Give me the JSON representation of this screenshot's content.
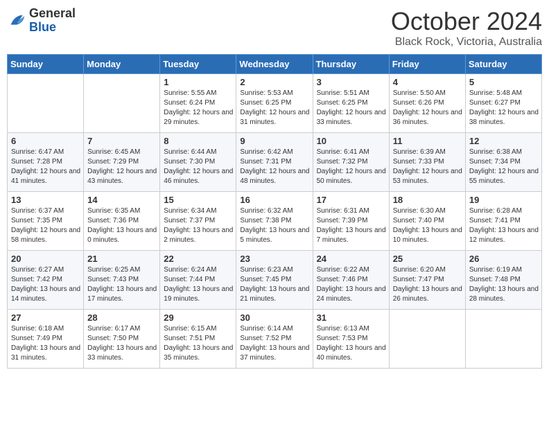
{
  "header": {
    "logo": {
      "general": "General",
      "blue": "Blue"
    },
    "title": "October 2024",
    "location": "Black Rock, Victoria, Australia"
  },
  "days_of_week": [
    "Sunday",
    "Monday",
    "Tuesday",
    "Wednesday",
    "Thursday",
    "Friday",
    "Saturday"
  ],
  "weeks": [
    [
      {
        "day": "",
        "sunrise": "",
        "sunset": "",
        "daylight": ""
      },
      {
        "day": "",
        "sunrise": "",
        "sunset": "",
        "daylight": ""
      },
      {
        "day": "1",
        "sunrise": "Sunrise: 5:55 AM",
        "sunset": "Sunset: 6:24 PM",
        "daylight": "Daylight: 12 hours and 29 minutes."
      },
      {
        "day": "2",
        "sunrise": "Sunrise: 5:53 AM",
        "sunset": "Sunset: 6:25 PM",
        "daylight": "Daylight: 12 hours and 31 minutes."
      },
      {
        "day": "3",
        "sunrise": "Sunrise: 5:51 AM",
        "sunset": "Sunset: 6:25 PM",
        "daylight": "Daylight: 12 hours and 33 minutes."
      },
      {
        "day": "4",
        "sunrise": "Sunrise: 5:50 AM",
        "sunset": "Sunset: 6:26 PM",
        "daylight": "Daylight: 12 hours and 36 minutes."
      },
      {
        "day": "5",
        "sunrise": "Sunrise: 5:48 AM",
        "sunset": "Sunset: 6:27 PM",
        "daylight": "Daylight: 12 hours and 38 minutes."
      }
    ],
    [
      {
        "day": "6",
        "sunrise": "Sunrise: 6:47 AM",
        "sunset": "Sunset: 7:28 PM",
        "daylight": "Daylight: 12 hours and 41 minutes."
      },
      {
        "day": "7",
        "sunrise": "Sunrise: 6:45 AM",
        "sunset": "Sunset: 7:29 PM",
        "daylight": "Daylight: 12 hours and 43 minutes."
      },
      {
        "day": "8",
        "sunrise": "Sunrise: 6:44 AM",
        "sunset": "Sunset: 7:30 PM",
        "daylight": "Daylight: 12 hours and 46 minutes."
      },
      {
        "day": "9",
        "sunrise": "Sunrise: 6:42 AM",
        "sunset": "Sunset: 7:31 PM",
        "daylight": "Daylight: 12 hours and 48 minutes."
      },
      {
        "day": "10",
        "sunrise": "Sunrise: 6:41 AM",
        "sunset": "Sunset: 7:32 PM",
        "daylight": "Daylight: 12 hours and 50 minutes."
      },
      {
        "day": "11",
        "sunrise": "Sunrise: 6:39 AM",
        "sunset": "Sunset: 7:33 PM",
        "daylight": "Daylight: 12 hours and 53 minutes."
      },
      {
        "day": "12",
        "sunrise": "Sunrise: 6:38 AM",
        "sunset": "Sunset: 7:34 PM",
        "daylight": "Daylight: 12 hours and 55 minutes."
      }
    ],
    [
      {
        "day": "13",
        "sunrise": "Sunrise: 6:37 AM",
        "sunset": "Sunset: 7:35 PM",
        "daylight": "Daylight: 12 hours and 58 minutes."
      },
      {
        "day": "14",
        "sunrise": "Sunrise: 6:35 AM",
        "sunset": "Sunset: 7:36 PM",
        "daylight": "Daylight: 13 hours and 0 minutes."
      },
      {
        "day": "15",
        "sunrise": "Sunrise: 6:34 AM",
        "sunset": "Sunset: 7:37 PM",
        "daylight": "Daylight: 13 hours and 2 minutes."
      },
      {
        "day": "16",
        "sunrise": "Sunrise: 6:32 AM",
        "sunset": "Sunset: 7:38 PM",
        "daylight": "Daylight: 13 hours and 5 minutes."
      },
      {
        "day": "17",
        "sunrise": "Sunrise: 6:31 AM",
        "sunset": "Sunset: 7:39 PM",
        "daylight": "Daylight: 13 hours and 7 minutes."
      },
      {
        "day": "18",
        "sunrise": "Sunrise: 6:30 AM",
        "sunset": "Sunset: 7:40 PM",
        "daylight": "Daylight: 13 hours and 10 minutes."
      },
      {
        "day": "19",
        "sunrise": "Sunrise: 6:28 AM",
        "sunset": "Sunset: 7:41 PM",
        "daylight": "Daylight: 13 hours and 12 minutes."
      }
    ],
    [
      {
        "day": "20",
        "sunrise": "Sunrise: 6:27 AM",
        "sunset": "Sunset: 7:42 PM",
        "daylight": "Daylight: 13 hours and 14 minutes."
      },
      {
        "day": "21",
        "sunrise": "Sunrise: 6:25 AM",
        "sunset": "Sunset: 7:43 PM",
        "daylight": "Daylight: 13 hours and 17 minutes."
      },
      {
        "day": "22",
        "sunrise": "Sunrise: 6:24 AM",
        "sunset": "Sunset: 7:44 PM",
        "daylight": "Daylight: 13 hours and 19 minutes."
      },
      {
        "day": "23",
        "sunrise": "Sunrise: 6:23 AM",
        "sunset": "Sunset: 7:45 PM",
        "daylight": "Daylight: 13 hours and 21 minutes."
      },
      {
        "day": "24",
        "sunrise": "Sunrise: 6:22 AM",
        "sunset": "Sunset: 7:46 PM",
        "daylight": "Daylight: 13 hours and 24 minutes."
      },
      {
        "day": "25",
        "sunrise": "Sunrise: 6:20 AM",
        "sunset": "Sunset: 7:47 PM",
        "daylight": "Daylight: 13 hours and 26 minutes."
      },
      {
        "day": "26",
        "sunrise": "Sunrise: 6:19 AM",
        "sunset": "Sunset: 7:48 PM",
        "daylight": "Daylight: 13 hours and 28 minutes."
      }
    ],
    [
      {
        "day": "27",
        "sunrise": "Sunrise: 6:18 AM",
        "sunset": "Sunset: 7:49 PM",
        "daylight": "Daylight: 13 hours and 31 minutes."
      },
      {
        "day": "28",
        "sunrise": "Sunrise: 6:17 AM",
        "sunset": "Sunset: 7:50 PM",
        "daylight": "Daylight: 13 hours and 33 minutes."
      },
      {
        "day": "29",
        "sunrise": "Sunrise: 6:15 AM",
        "sunset": "Sunset: 7:51 PM",
        "daylight": "Daylight: 13 hours and 35 minutes."
      },
      {
        "day": "30",
        "sunrise": "Sunrise: 6:14 AM",
        "sunset": "Sunset: 7:52 PM",
        "daylight": "Daylight: 13 hours and 37 minutes."
      },
      {
        "day": "31",
        "sunrise": "Sunrise: 6:13 AM",
        "sunset": "Sunset: 7:53 PM",
        "daylight": "Daylight: 13 hours and 40 minutes."
      },
      {
        "day": "",
        "sunrise": "",
        "sunset": "",
        "daylight": ""
      },
      {
        "day": "",
        "sunrise": "",
        "sunset": "",
        "daylight": ""
      }
    ]
  ]
}
